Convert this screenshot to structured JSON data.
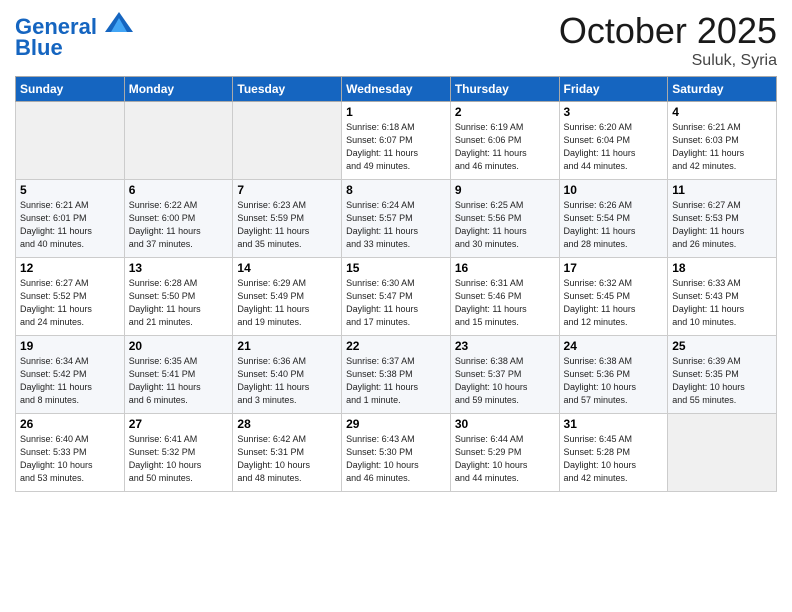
{
  "header": {
    "logo_line1": "General",
    "logo_line2": "Blue",
    "month": "October 2025",
    "location": "Suluk, Syria"
  },
  "days_of_week": [
    "Sunday",
    "Monday",
    "Tuesday",
    "Wednesday",
    "Thursday",
    "Friday",
    "Saturday"
  ],
  "weeks": [
    [
      {
        "day": "",
        "content": ""
      },
      {
        "day": "",
        "content": ""
      },
      {
        "day": "",
        "content": ""
      },
      {
        "day": "1",
        "content": "Sunrise: 6:18 AM\nSunset: 6:07 PM\nDaylight: 11 hours\nand 49 minutes."
      },
      {
        "day": "2",
        "content": "Sunrise: 6:19 AM\nSunset: 6:06 PM\nDaylight: 11 hours\nand 46 minutes."
      },
      {
        "day": "3",
        "content": "Sunrise: 6:20 AM\nSunset: 6:04 PM\nDaylight: 11 hours\nand 44 minutes."
      },
      {
        "day": "4",
        "content": "Sunrise: 6:21 AM\nSunset: 6:03 PM\nDaylight: 11 hours\nand 42 minutes."
      }
    ],
    [
      {
        "day": "5",
        "content": "Sunrise: 6:21 AM\nSunset: 6:01 PM\nDaylight: 11 hours\nand 40 minutes."
      },
      {
        "day": "6",
        "content": "Sunrise: 6:22 AM\nSunset: 6:00 PM\nDaylight: 11 hours\nand 37 minutes."
      },
      {
        "day": "7",
        "content": "Sunrise: 6:23 AM\nSunset: 5:59 PM\nDaylight: 11 hours\nand 35 minutes."
      },
      {
        "day": "8",
        "content": "Sunrise: 6:24 AM\nSunset: 5:57 PM\nDaylight: 11 hours\nand 33 minutes."
      },
      {
        "day": "9",
        "content": "Sunrise: 6:25 AM\nSunset: 5:56 PM\nDaylight: 11 hours\nand 30 minutes."
      },
      {
        "day": "10",
        "content": "Sunrise: 6:26 AM\nSunset: 5:54 PM\nDaylight: 11 hours\nand 28 minutes."
      },
      {
        "day": "11",
        "content": "Sunrise: 6:27 AM\nSunset: 5:53 PM\nDaylight: 11 hours\nand 26 minutes."
      }
    ],
    [
      {
        "day": "12",
        "content": "Sunrise: 6:27 AM\nSunset: 5:52 PM\nDaylight: 11 hours\nand 24 minutes."
      },
      {
        "day": "13",
        "content": "Sunrise: 6:28 AM\nSunset: 5:50 PM\nDaylight: 11 hours\nand 21 minutes."
      },
      {
        "day": "14",
        "content": "Sunrise: 6:29 AM\nSunset: 5:49 PM\nDaylight: 11 hours\nand 19 minutes."
      },
      {
        "day": "15",
        "content": "Sunrise: 6:30 AM\nSunset: 5:47 PM\nDaylight: 11 hours\nand 17 minutes."
      },
      {
        "day": "16",
        "content": "Sunrise: 6:31 AM\nSunset: 5:46 PM\nDaylight: 11 hours\nand 15 minutes."
      },
      {
        "day": "17",
        "content": "Sunrise: 6:32 AM\nSunset: 5:45 PM\nDaylight: 11 hours\nand 12 minutes."
      },
      {
        "day": "18",
        "content": "Sunrise: 6:33 AM\nSunset: 5:43 PM\nDaylight: 11 hours\nand 10 minutes."
      }
    ],
    [
      {
        "day": "19",
        "content": "Sunrise: 6:34 AM\nSunset: 5:42 PM\nDaylight: 11 hours\nand 8 minutes."
      },
      {
        "day": "20",
        "content": "Sunrise: 6:35 AM\nSunset: 5:41 PM\nDaylight: 11 hours\nand 6 minutes."
      },
      {
        "day": "21",
        "content": "Sunrise: 6:36 AM\nSunset: 5:40 PM\nDaylight: 11 hours\nand 3 minutes."
      },
      {
        "day": "22",
        "content": "Sunrise: 6:37 AM\nSunset: 5:38 PM\nDaylight: 11 hours\nand 1 minute."
      },
      {
        "day": "23",
        "content": "Sunrise: 6:38 AM\nSunset: 5:37 PM\nDaylight: 10 hours\nand 59 minutes."
      },
      {
        "day": "24",
        "content": "Sunrise: 6:38 AM\nSunset: 5:36 PM\nDaylight: 10 hours\nand 57 minutes."
      },
      {
        "day": "25",
        "content": "Sunrise: 6:39 AM\nSunset: 5:35 PM\nDaylight: 10 hours\nand 55 minutes."
      }
    ],
    [
      {
        "day": "26",
        "content": "Sunrise: 6:40 AM\nSunset: 5:33 PM\nDaylight: 10 hours\nand 53 minutes."
      },
      {
        "day": "27",
        "content": "Sunrise: 6:41 AM\nSunset: 5:32 PM\nDaylight: 10 hours\nand 50 minutes."
      },
      {
        "day": "28",
        "content": "Sunrise: 6:42 AM\nSunset: 5:31 PM\nDaylight: 10 hours\nand 48 minutes."
      },
      {
        "day": "29",
        "content": "Sunrise: 6:43 AM\nSunset: 5:30 PM\nDaylight: 10 hours\nand 46 minutes."
      },
      {
        "day": "30",
        "content": "Sunrise: 6:44 AM\nSunset: 5:29 PM\nDaylight: 10 hours\nand 44 minutes."
      },
      {
        "day": "31",
        "content": "Sunrise: 6:45 AM\nSunset: 5:28 PM\nDaylight: 10 hours\nand 42 minutes."
      },
      {
        "day": "",
        "content": ""
      }
    ]
  ]
}
